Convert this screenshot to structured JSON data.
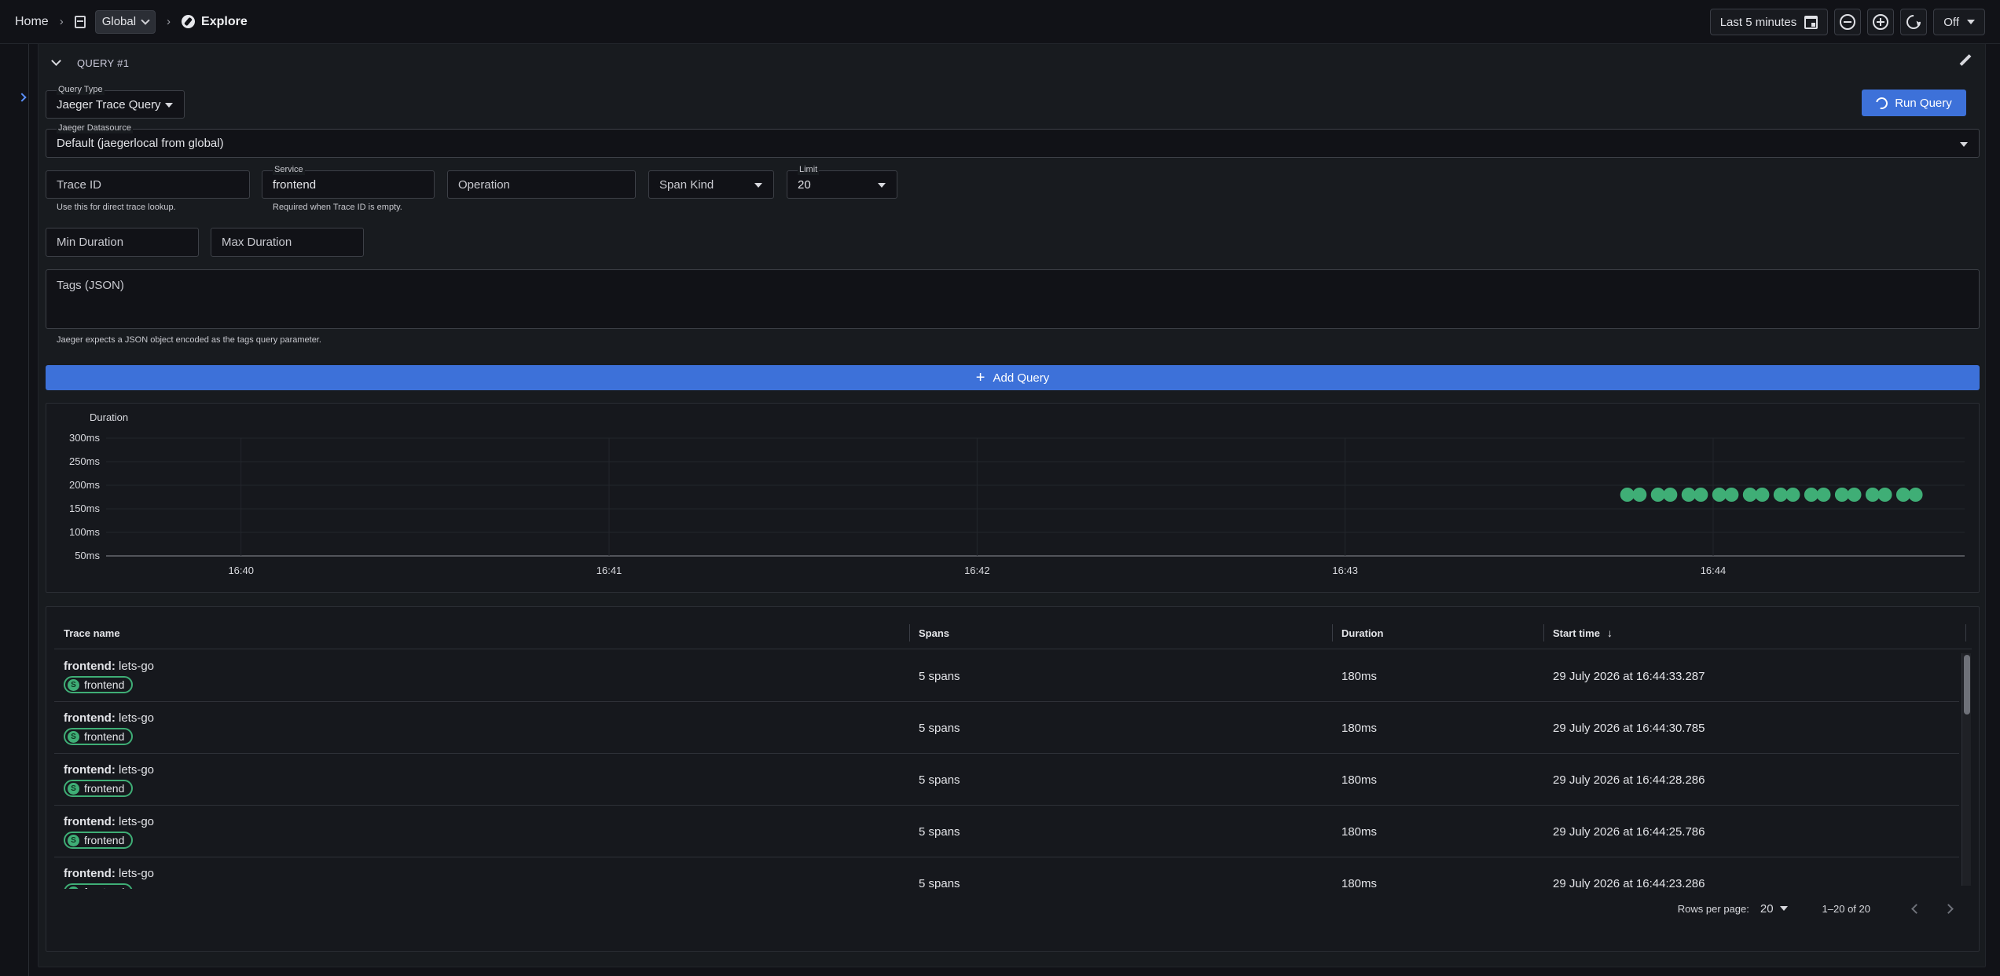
{
  "breadcrumb": {
    "home": "Home",
    "scope": "Global",
    "page": "Explore"
  },
  "toolbar": {
    "time_range": "Last 5 minutes",
    "refresh_interval": "Off"
  },
  "query": {
    "title": "QUERY #1",
    "run_label": "Run Query",
    "query_type": {
      "label": "Query Type",
      "value": "Jaeger Trace Query"
    },
    "datasource": {
      "label": "Jaeger Datasource",
      "value": "Default (jaegerlocal from global)"
    },
    "trace_id": {
      "placeholder": "Trace ID",
      "helper": "Use this for direct trace lookup."
    },
    "service": {
      "label": "Service",
      "value": "frontend",
      "helper": "Required when Trace ID is empty."
    },
    "operation": {
      "placeholder": "Operation"
    },
    "span_kind": {
      "placeholder": "Span Kind"
    },
    "limit": {
      "label": "Limit",
      "value": "20"
    },
    "min_duration": {
      "placeholder": "Min Duration"
    },
    "max_duration": {
      "placeholder": "Max Duration"
    },
    "tags": {
      "placeholder": "Tags (JSON)",
      "helper": "Jaeger expects a JSON object encoded as the tags query parameter."
    },
    "add_label": "Add Query"
  },
  "chart_data": {
    "type": "scatter",
    "ylabel": "Duration",
    "yticks": [
      "50ms",
      "100ms",
      "150ms",
      "200ms",
      "250ms",
      "300ms"
    ],
    "ylim": [
      50,
      300
    ],
    "xticks": [
      "16:40",
      "16:41",
      "16:42",
      "16:43",
      "16:44"
    ],
    "xlim": [
      "16:39:38",
      "16:44:41"
    ],
    "point_color": "#3fae76",
    "series": [
      {
        "x": [
          "16:43:46",
          "16:43:48",
          "16:43:51",
          "16:43:53",
          "16:43:56",
          "16:43:58",
          "16:44:01",
          "16:44:03",
          "16:44:06",
          "16:44:08",
          "16:44:11",
          "16:44:13",
          "16:44:16",
          "16:44:18",
          "16:44:21",
          "16:44:23",
          "16:44:26",
          "16:44:28",
          "16:44:31",
          "16:44:33"
        ],
        "y": [
          180,
          180,
          180,
          180,
          180,
          180,
          180,
          180,
          180,
          180,
          180,
          180,
          180,
          180,
          180,
          180,
          180,
          180,
          180,
          180
        ]
      }
    ]
  },
  "table": {
    "columns": {
      "name": "Trace name",
      "spans": "Spans",
      "duration": "Duration",
      "start": "Start time"
    },
    "rows": [
      {
        "service": "frontend:",
        "operation": "lets-go",
        "badge": "frontend",
        "spans": "5 spans",
        "duration": "180ms",
        "start": "29 July 2026 at 16:44:33.287"
      },
      {
        "service": "frontend:",
        "operation": "lets-go",
        "badge": "frontend",
        "spans": "5 spans",
        "duration": "180ms",
        "start": "29 July 2026 at 16:44:30.785"
      },
      {
        "service": "frontend:",
        "operation": "lets-go",
        "badge": "frontend",
        "spans": "5 spans",
        "duration": "180ms",
        "start": "29 July 2026 at 16:44:28.286"
      },
      {
        "service": "frontend:",
        "operation": "lets-go",
        "badge": "frontend",
        "spans": "5 spans",
        "duration": "180ms",
        "start": "29 July 2026 at 16:44:25.786"
      },
      {
        "service": "frontend:",
        "operation": "lets-go",
        "badge": "frontend",
        "spans": "5 spans",
        "duration": "180ms",
        "start": "29 July 2026 at 16:44:23.286"
      }
    ],
    "pagination": {
      "rows_label": "Rows per page:",
      "rows_value": "20",
      "range": "1–20 of 20"
    }
  }
}
